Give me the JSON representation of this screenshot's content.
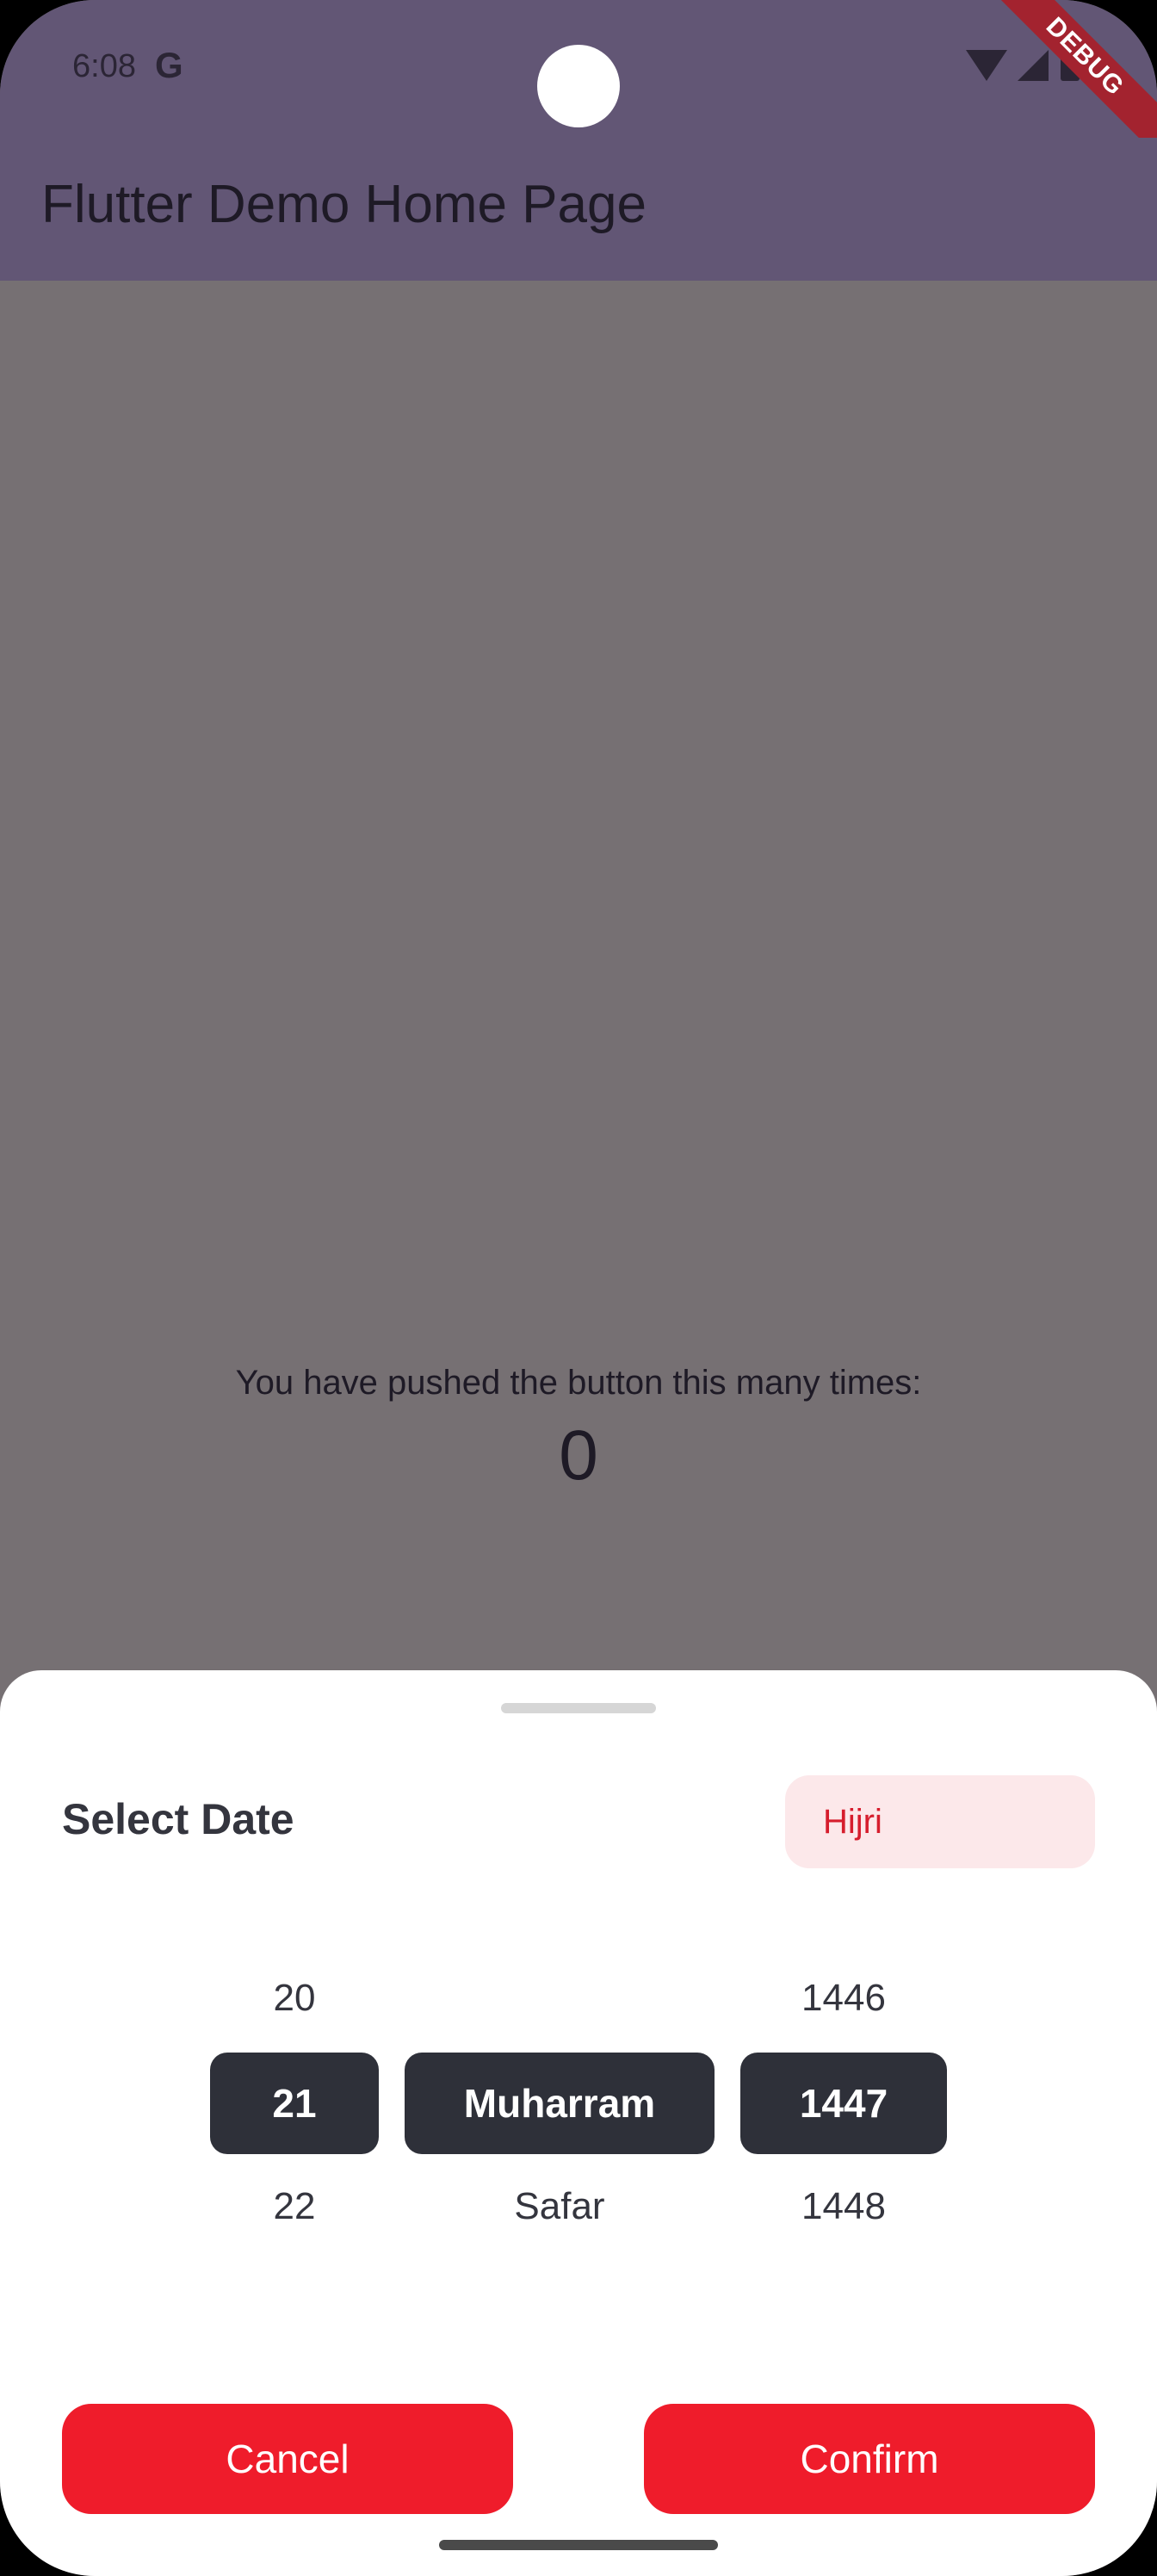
{
  "status_bar": {
    "time": "6:08",
    "google_icon": "G",
    "debug_label": "DEBUG"
  },
  "app_bar": {
    "title": "Flutter Demo Home Page"
  },
  "counter": {
    "label": "You have pushed the button this many times:",
    "value": "0"
  },
  "sheet": {
    "title": "Select Date",
    "calendar_toggle": "Hijri",
    "day": {
      "prev": "20",
      "selected": "21",
      "next": "22"
    },
    "month": {
      "selected": "Muharram",
      "next": "Safar"
    },
    "year": {
      "prev": "1446",
      "selected": "1447",
      "next": "1448"
    },
    "cancel_label": "Cancel",
    "confirm_label": "Confirm"
  },
  "colors": {
    "accent": "#ef1c2b",
    "appbar": "#625675",
    "scrim": "#767073",
    "selected_chip": "#2e3039"
  }
}
